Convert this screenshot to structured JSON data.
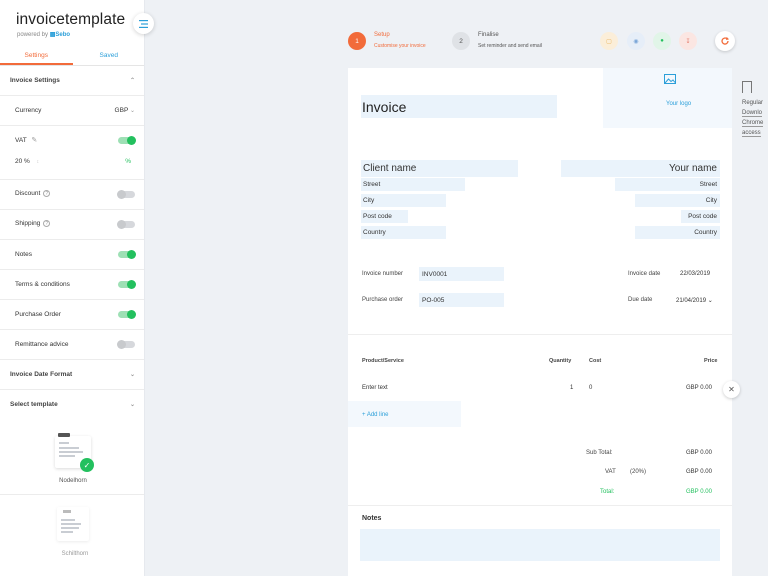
{
  "sidebar": {
    "brand": "invoicetemplate",
    "powered_prefix": "powered by",
    "powered_brand": "Sebo",
    "tabs": [
      "Settings",
      "Saved"
    ],
    "invoice_settings": "Invoice Settings",
    "currency_label": "Currency",
    "currency_value": "GBP",
    "vat_label": "VAT",
    "vat_rate": "20 %",
    "vat_pct": "%",
    "discount": "Discount",
    "shipping": "Shipping",
    "notes": "Notes",
    "terms": "Terms & conditions",
    "purchase_order": "Purchase Order",
    "remittance": "Remittance advice",
    "date_format": "Invoice Date Format",
    "select_template": "Select template",
    "templates": [
      "Nodelhorn",
      "Schilthorn"
    ]
  },
  "stepper": {
    "step1_num": "1",
    "step1_title": "Setup",
    "step1_sub": "Customise your invoice",
    "step2_num": "2",
    "step2_title": "Finalise",
    "step2_sub": "Set reminder and send email"
  },
  "invoice": {
    "title": "Invoice",
    "logo_label": "Your logo",
    "client": {
      "name": "Client name",
      "street": "Street",
      "city": "City",
      "postcode": "Post code",
      "country": "Country"
    },
    "you": {
      "name": "Your name",
      "street": "Street",
      "city": "City",
      "postcode": "Post code",
      "country": "Country"
    },
    "invoice_number_label": "Invoice number",
    "invoice_number": "INV0001",
    "purchase_order_label": "Purchase order",
    "purchase_order": "PO-005",
    "invoice_date_label": "Invoice date",
    "invoice_date": "22/03/2019",
    "due_date_label": "Due date",
    "due_date": "21/04/2019",
    "table_headers": {
      "product": "Product/Service",
      "quantity": "Quantity",
      "cost": "Cost",
      "price": "Price"
    },
    "line": {
      "product": "Enter text",
      "quantity": "1",
      "cost": "0",
      "price": "GBP 0.00"
    },
    "add_line": "+ Add line",
    "subtotal_label": "Sub Total:",
    "subtotal": "GBP 0.00",
    "vat_label": "VAT",
    "vat_pct": "(20%)",
    "vat_amount": "GBP 0.00",
    "total_label": "Total:",
    "total": "GBP 0.00",
    "notes_label": "Notes"
  },
  "right_panel": {
    "lines": [
      "Regular",
      "Downlo",
      "Chrome",
      "access"
    ]
  },
  "colors": {
    "accent": "#f26b3a",
    "toggle_on": "#23c05e",
    "field_bg": "#eaf3fb",
    "link": "#2b9fd9"
  }
}
